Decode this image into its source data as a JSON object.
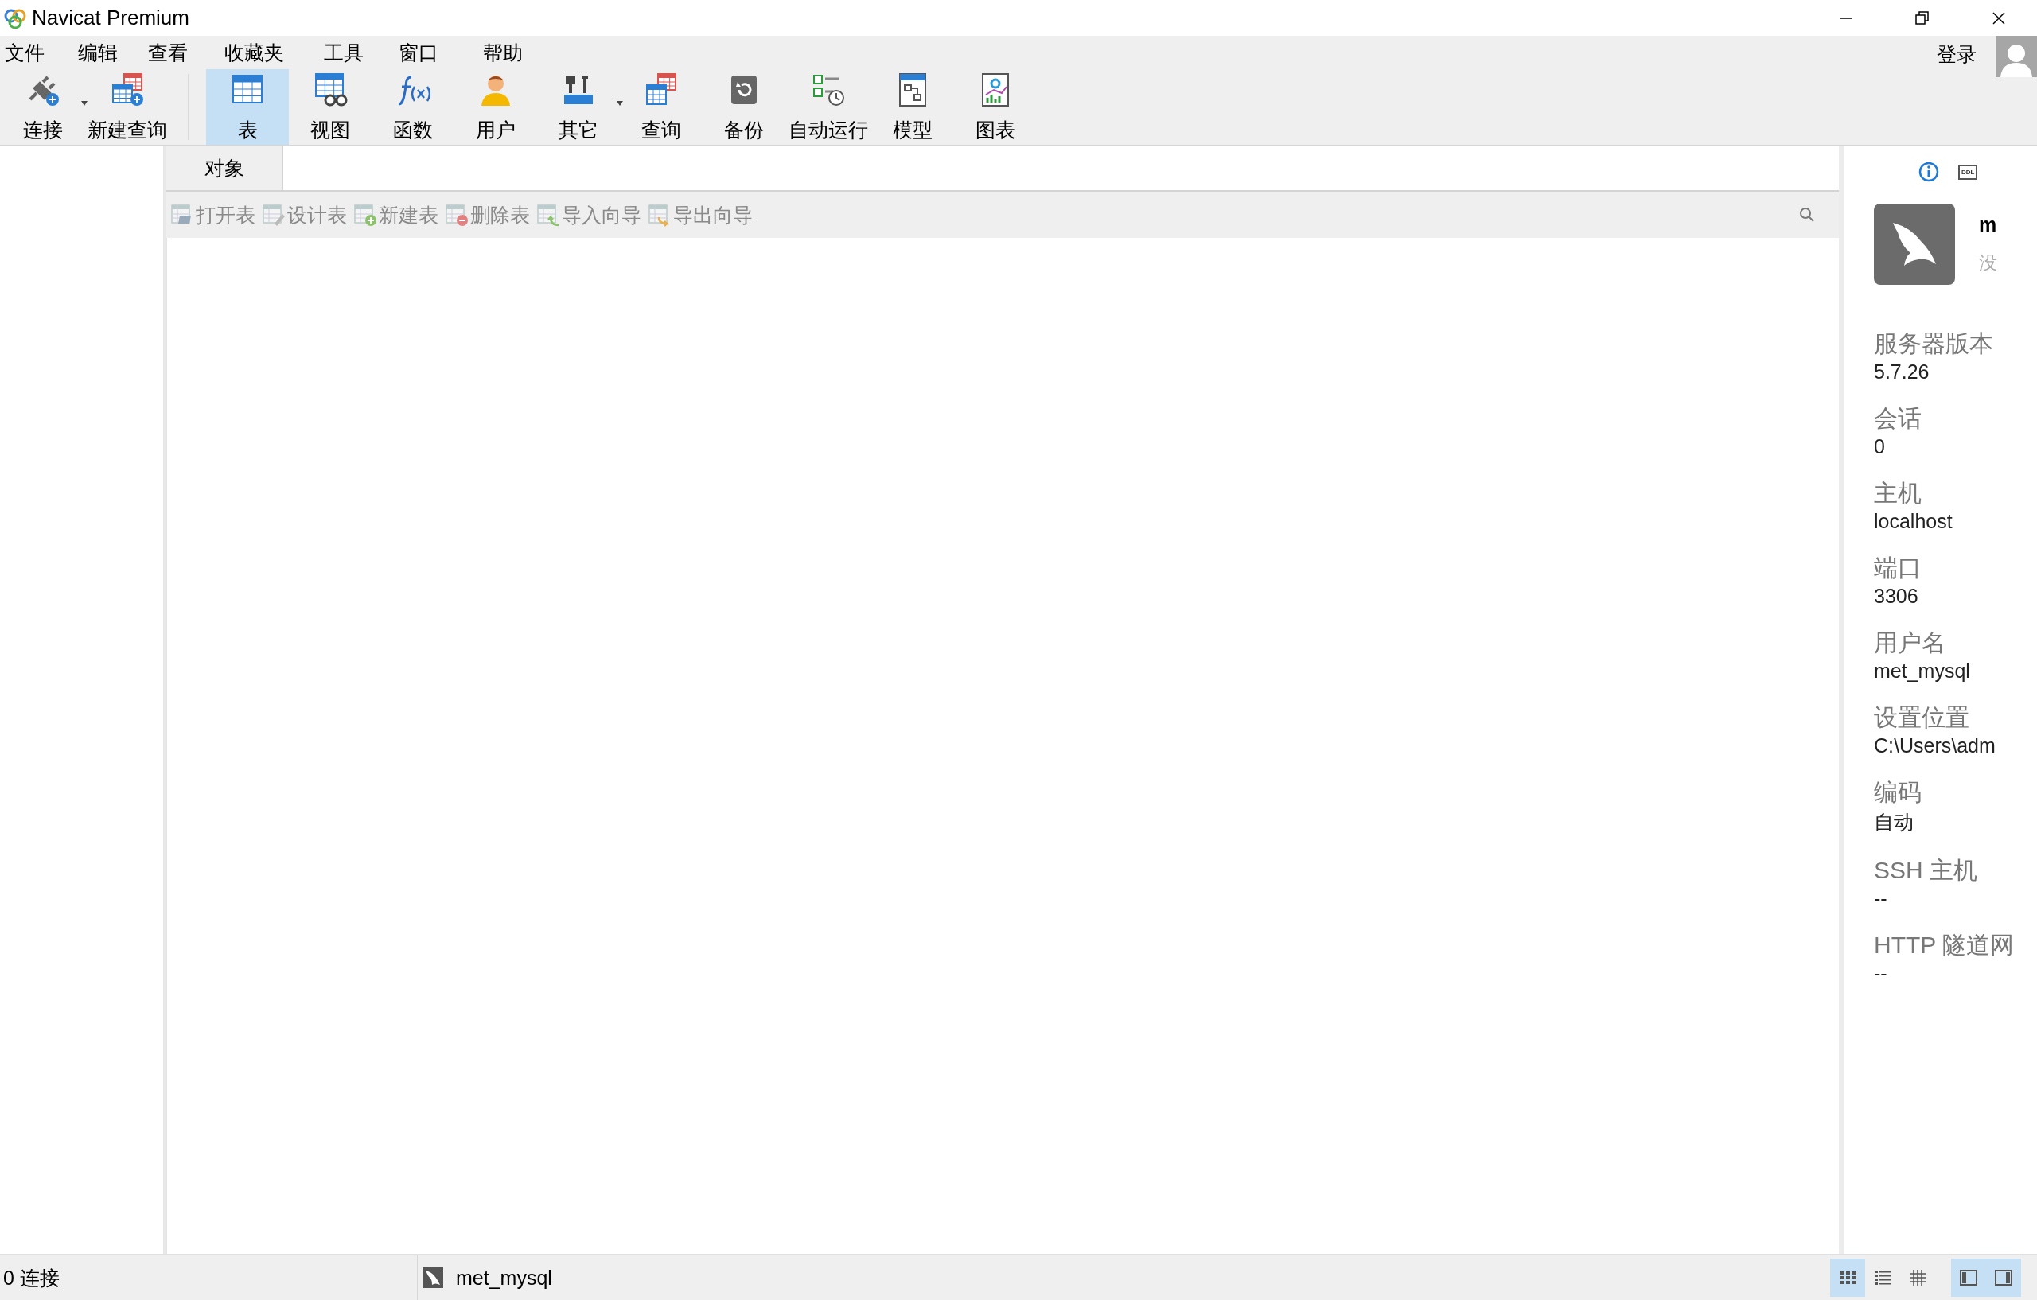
{
  "window": {
    "title": "Navicat Premium"
  },
  "menu": [
    "文件",
    "编辑",
    "查看",
    "收藏夹",
    "工具",
    "窗口",
    "帮助"
  ],
  "login": {
    "label": "登录"
  },
  "toolbar_groups": [
    {
      "items": [
        {
          "label": "连接",
          "kind": "connect",
          "selected": false,
          "dropdown": true
        },
        {
          "label": "新建查询",
          "kind": "newquery",
          "selected": false,
          "dropdown": false
        }
      ]
    },
    {
      "items": [
        {
          "label": "表",
          "kind": "table",
          "selected": true,
          "dropdown": false
        },
        {
          "label": "视图",
          "kind": "view",
          "selected": false,
          "dropdown": false
        },
        {
          "label": "函数",
          "kind": "function",
          "selected": false,
          "dropdown": false
        },
        {
          "label": "用户",
          "kind": "user",
          "selected": false,
          "dropdown": false
        },
        {
          "label": "其它",
          "kind": "tools",
          "selected": false,
          "dropdown": true
        },
        {
          "label": "查询",
          "kind": "query",
          "selected": false,
          "dropdown": false
        },
        {
          "label": "备份",
          "kind": "backup",
          "selected": false,
          "dropdown": false
        },
        {
          "label": "自动运行",
          "kind": "schedule",
          "selected": false,
          "dropdown": false
        },
        {
          "label": "模型",
          "kind": "model",
          "selected": false,
          "dropdown": false
        },
        {
          "label": "图表",
          "kind": "chart",
          "selected": false,
          "dropdown": false
        }
      ]
    }
  ],
  "tabs": [
    {
      "label": "对象",
      "selected": true
    }
  ],
  "object_actions": [
    {
      "label": "打开表",
      "kind": "open",
      "disabled": true
    },
    {
      "label": "设计表",
      "kind": "design",
      "disabled": true
    },
    {
      "label": "新建表",
      "kind": "new",
      "disabled": true
    },
    {
      "label": "删除表",
      "kind": "delete",
      "disabled": true
    },
    {
      "label": "导入向导",
      "kind": "import",
      "disabled": true
    },
    {
      "label": "导出向导",
      "kind": "export",
      "disabled": true
    }
  ],
  "info_panel": {
    "tabs": [
      {
        "kind": "info",
        "selected": true
      },
      {
        "kind": "ddl",
        "label": "DDL",
        "selected": false
      }
    ],
    "name": "m",
    "subtitle": "没",
    "properties": [
      {
        "label": "服务器版本",
        "value": "5.7.26"
      },
      {
        "label": "会话",
        "value": "0"
      },
      {
        "label": "主机",
        "value": "localhost"
      },
      {
        "label": "端口",
        "value": "3306"
      },
      {
        "label": "用户名",
        "value": "met_mysql"
      },
      {
        "label": "设置位置",
        "value": "C:\\Users\\adm"
      },
      {
        "label": "编码",
        "value": "自动"
      },
      {
        "label": "SSH 主机",
        "value": "--"
      },
      {
        "label": "HTTP 隧道网",
        "value": "--"
      }
    ]
  },
  "status_bar": {
    "connections": "0 连接",
    "connection_name": "met_mysql",
    "view_modes": [
      {
        "kind": "grid",
        "selected": true
      },
      {
        "kind": "list",
        "selected": false
      },
      {
        "kind": "detail",
        "selected": false
      }
    ],
    "panels": [
      {
        "kind": "left",
        "selected": true
      },
      {
        "kind": "right",
        "selected": true
      }
    ]
  }
}
